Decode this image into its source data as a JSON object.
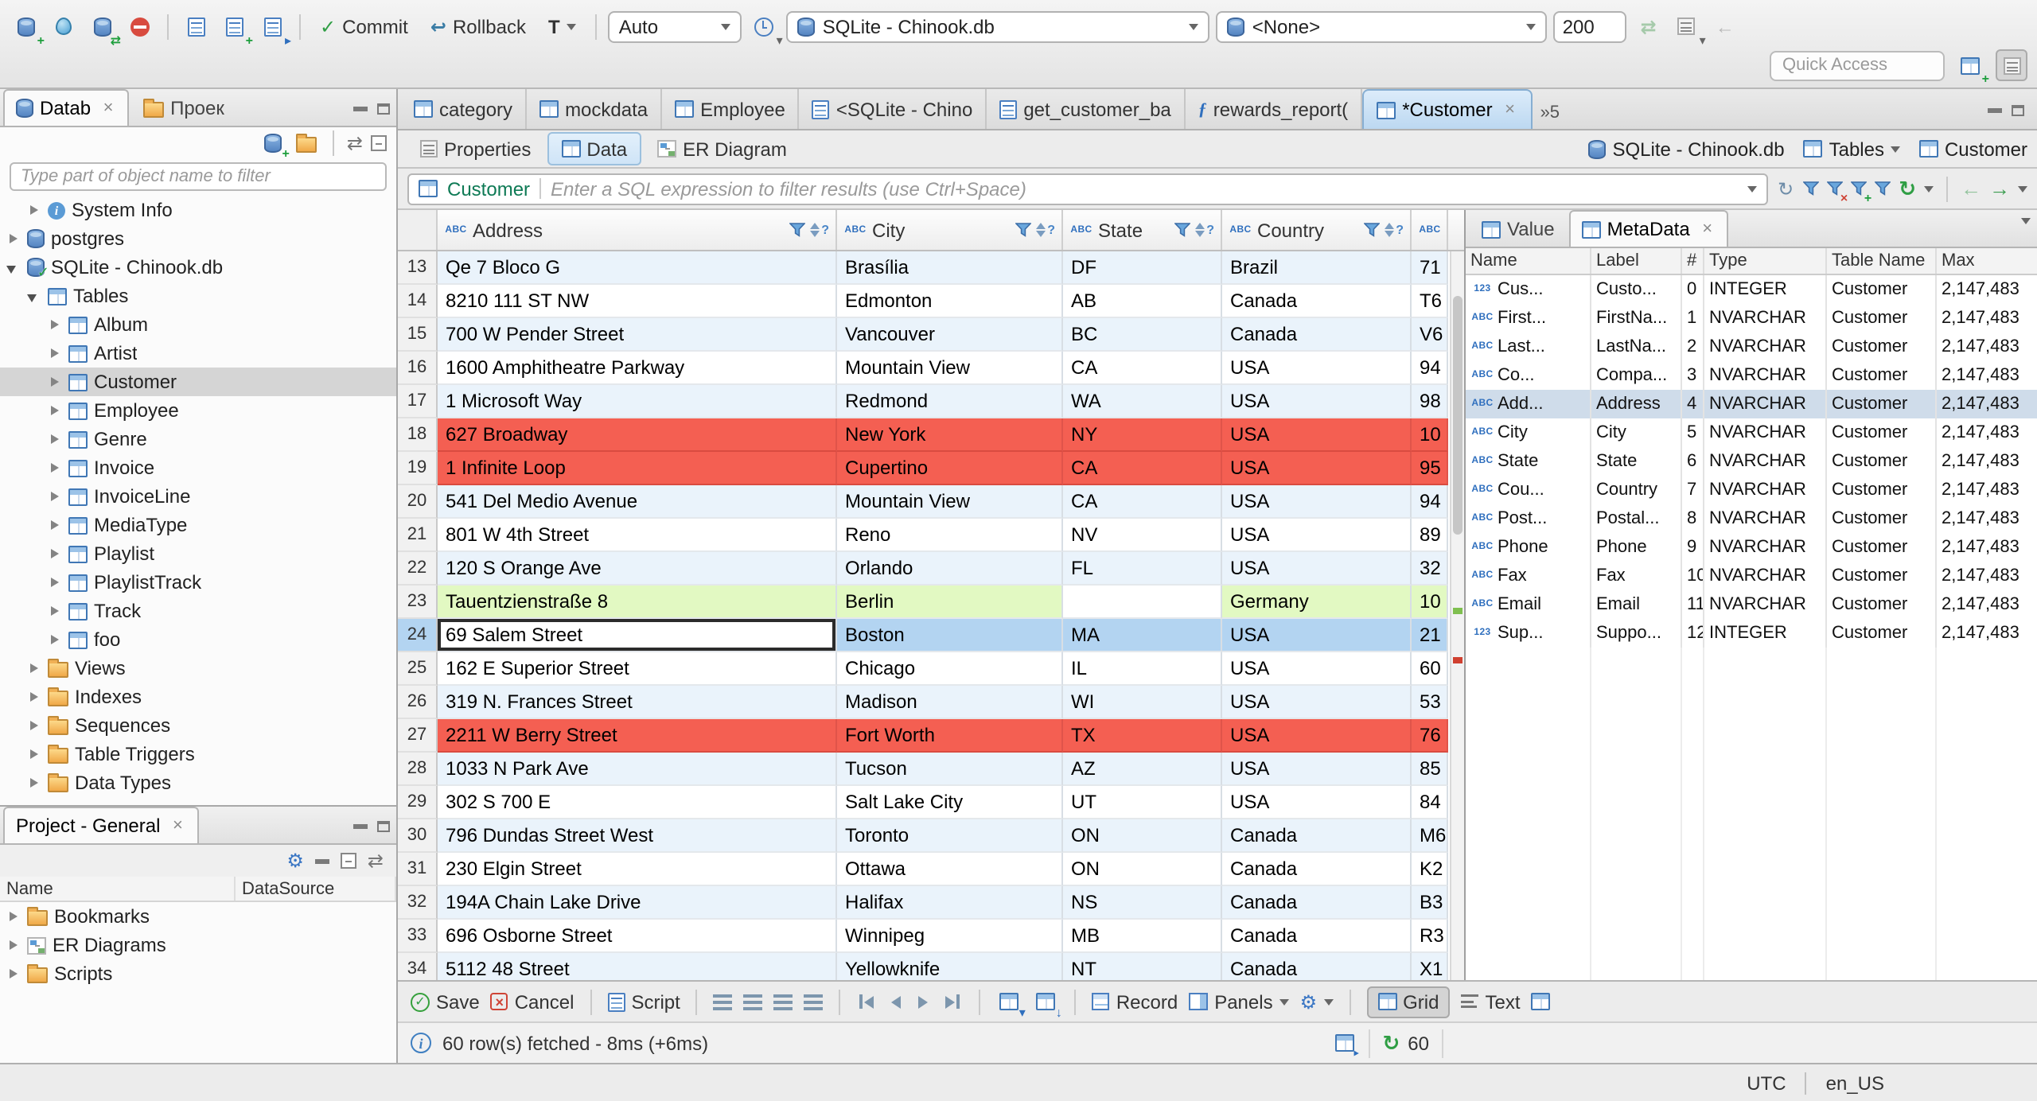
{
  "colors": {
    "accent_blue": "#3f7fc1",
    "row_red": "#f45f52",
    "row_green": "#e2f9c2",
    "selected_row_blue": "#b3d4f1",
    "active_tab_blue": "#bcd8f1",
    "filter_table_name_green": "#0e7a55",
    "refresh_green": "#2f9e44"
  },
  "toolbar": {
    "commit": "Commit",
    "rollback": "Rollback",
    "txn_mode": "T",
    "auto": "Auto",
    "connection": "SQLite - Chinook.db",
    "schema": "<None>",
    "fetch_size": "200",
    "quick_access": "Quick Access"
  },
  "navigator": {
    "tab_database": "Datab",
    "tab_projects": "Проек",
    "filter_placeholder": "Type part of object name to filter",
    "tree": [
      {
        "label": "System Info",
        "icon": "system-info",
        "depth": 1
      },
      {
        "label": "postgres",
        "icon": "database",
        "depth": 0
      },
      {
        "label": "SQLite - Chinook.db",
        "icon": "database-connected",
        "depth": 0,
        "expanded": true
      },
      {
        "label": "Tables",
        "icon": "table",
        "depth": 1,
        "expanded": true
      },
      {
        "label": "Album",
        "icon": "table",
        "depth": 2
      },
      {
        "label": "Artist",
        "icon": "table",
        "depth": 2
      },
      {
        "label": "Customer",
        "icon": "table",
        "depth": 2,
        "selected": true
      },
      {
        "label": "Employee",
        "icon": "table",
        "depth": 2
      },
      {
        "label": "Genre",
        "icon": "table",
        "depth": 2
      },
      {
        "label": "Invoice",
        "icon": "table",
        "depth": 2
      },
      {
        "label": "InvoiceLine",
        "icon": "table",
        "depth": 2
      },
      {
        "label": "MediaType",
        "icon": "table",
        "depth": 2
      },
      {
        "label": "Playlist",
        "icon": "table",
        "depth": 2
      },
      {
        "label": "PlaylistTrack",
        "icon": "table",
        "depth": 2
      },
      {
        "label": "Track",
        "icon": "table",
        "depth": 2
      },
      {
        "label": "foo",
        "icon": "table",
        "depth": 2
      },
      {
        "label": "Views",
        "icon": "folder",
        "depth": 1
      },
      {
        "label": "Indexes",
        "icon": "folder",
        "depth": 1
      },
      {
        "label": "Sequences",
        "icon": "folder",
        "depth": 1
      },
      {
        "label": "Table Triggers",
        "icon": "folder",
        "depth": 1
      },
      {
        "label": "Data Types",
        "icon": "folder",
        "depth": 1
      }
    ]
  },
  "project_panel": {
    "tab": "Project - General",
    "columns": [
      "Name",
      "DataSource"
    ],
    "items": [
      {
        "label": "Bookmarks",
        "icon": "folder"
      },
      {
        "label": "ER Diagrams",
        "icon": "diagram"
      },
      {
        "label": "Scripts",
        "icon": "folder"
      }
    ]
  },
  "editor": {
    "tabs": [
      {
        "label": "category",
        "icon": "table"
      },
      {
        "label": "mockdata",
        "icon": "table"
      },
      {
        "label": "Employee",
        "icon": "table"
      },
      {
        "label": "<SQLite - Chino",
        "icon": "sql"
      },
      {
        "label": "get_customer_ba",
        "icon": "sql"
      },
      {
        "label": "rewards_report(",
        "icon": "function"
      },
      {
        "label": "*Customer",
        "icon": "table",
        "active": true,
        "closable": true
      }
    ],
    "hidden_tabs": "»5",
    "subtabs": [
      {
        "label": "Properties",
        "icon": "properties"
      },
      {
        "label": "Data",
        "icon": "table",
        "active": true
      },
      {
        "label": "ER Diagram",
        "icon": "diagram"
      }
    ],
    "breadcrumb": [
      {
        "label": "SQLite - Chinook.db",
        "icon": "database"
      },
      {
        "label": "Tables",
        "icon": "table",
        "dropdown": true
      },
      {
        "label": "Customer",
        "icon": "table"
      }
    ],
    "filter_table": "Customer",
    "filter_placeholder": "Enter a SQL expression to filter results (use Ctrl+Space)"
  },
  "grid": {
    "columns": [
      {
        "label": "Address",
        "type": "abc"
      },
      {
        "label": "City",
        "type": "abc"
      },
      {
        "label": "State",
        "type": "abc"
      },
      {
        "label": "Country",
        "type": "abc"
      },
      {
        "label": "",
        "type": "abc"
      }
    ],
    "rows": [
      {
        "num": "13",
        "variant": "blue",
        "cells": [
          "Qe 7 Bloco G",
          "Brasília",
          "DF",
          "Brazil",
          "71"
        ]
      },
      {
        "num": "14",
        "variant": "white",
        "cells": [
          "8210 111 ST NW",
          "Edmonton",
          "AB",
          "Canada",
          "T6"
        ]
      },
      {
        "num": "15",
        "variant": "blue",
        "cells": [
          "700 W Pender Street",
          "Vancouver",
          "BC",
          "Canada",
          "V6"
        ]
      },
      {
        "num": "16",
        "variant": "white",
        "cells": [
          "1600 Amphitheatre Parkway",
          "Mountain View",
          "CA",
          "USA",
          "94"
        ]
      },
      {
        "num": "17",
        "variant": "blue",
        "cells": [
          "1 Microsoft Way",
          "Redmond",
          "WA",
          "USA",
          "98"
        ]
      },
      {
        "num": "18",
        "variant": "red",
        "cells": [
          "627 Broadway",
          "New York",
          "NY",
          "USA",
          "10"
        ]
      },
      {
        "num": "19",
        "variant": "red",
        "cells": [
          "1 Infinite Loop",
          "Cupertino",
          "CA",
          "USA",
          "95"
        ]
      },
      {
        "num": "20",
        "variant": "blue",
        "cells": [
          "541 Del Medio Avenue",
          "Mountain View",
          "CA",
          "USA",
          "94"
        ]
      },
      {
        "num": "21",
        "variant": "white",
        "cells": [
          "801 W 4th Street",
          "Reno",
          "NV",
          "USA",
          "89"
        ]
      },
      {
        "num": "22",
        "variant": "blue",
        "cells": [
          "120 S Orange Ave",
          "Orlando",
          "FL",
          "USA",
          "32"
        ]
      },
      {
        "num": "23",
        "variant": "green",
        "nullCells": [
          2
        ],
        "cells": [
          "Tauentzienstraße 8",
          "Berlin",
          "",
          "Germany",
          "10"
        ]
      },
      {
        "num": "24",
        "variant": "sel",
        "cells": [
          "69 Salem Street",
          "Boston",
          "MA",
          "USA",
          "21"
        ]
      },
      {
        "num": "25",
        "variant": "white",
        "cells": [
          "162 E Superior Street",
          "Chicago",
          "IL",
          "USA",
          "60"
        ]
      },
      {
        "num": "26",
        "variant": "blue",
        "cells": [
          "319 N. Frances Street",
          "Madison",
          "WI",
          "USA",
          "53"
        ]
      },
      {
        "num": "27",
        "variant": "red",
        "cells": [
          "2211 W Berry Street",
          "Fort Worth",
          "TX",
          "USA",
          "76"
        ]
      },
      {
        "num": "28",
        "variant": "blue",
        "cells": [
          "1033 N Park Ave",
          "Tucson",
          "AZ",
          "USA",
          "85"
        ]
      },
      {
        "num": "29",
        "variant": "white",
        "cells": [
          "302 S 700 E",
          "Salt Lake City",
          "UT",
          "USA",
          "84"
        ]
      },
      {
        "num": "30",
        "variant": "blue",
        "cells": [
          "796 Dundas Street West",
          "Toronto",
          "ON",
          "Canada",
          "M6"
        ]
      },
      {
        "num": "31",
        "variant": "white",
        "cells": [
          "230 Elgin Street",
          "Ottawa",
          "ON",
          "Canada",
          "K2"
        ]
      },
      {
        "num": "32",
        "variant": "blue",
        "cells": [
          "194A Chain Lake Drive",
          "Halifax",
          "NS",
          "Canada",
          "B3"
        ]
      },
      {
        "num": "33",
        "variant": "white",
        "cells": [
          "696 Osborne Street",
          "Winnipeg",
          "MB",
          "Canada",
          "R3"
        ]
      },
      {
        "num": "34",
        "variant": "blue",
        "cells": [
          "5112 48 Street",
          "Yellowknife",
          "NT",
          "Canada",
          "X1"
        ]
      }
    ]
  },
  "panel": {
    "tabs": [
      {
        "label": "Value",
        "icon": "grid"
      },
      {
        "label": "MetaData",
        "icon": "grid",
        "active": true,
        "closable": true
      }
    ],
    "columns": [
      "Name",
      "Label",
      "#",
      "Type",
      "Table Name",
      "Max"
    ],
    "rows": [
      {
        "icon": "123",
        "name": "Cus...",
        "label": "Custo...",
        "ord": "0",
        "type": "INTEGER",
        "table": "Customer",
        "max": "2,147,483"
      },
      {
        "icon": "abc",
        "name": "First...",
        "label": "FirstNa...",
        "ord": "1",
        "type": "NVARCHAR",
        "table": "Customer",
        "max": "2,147,483"
      },
      {
        "icon": "abc",
        "name": "Last...",
        "label": "LastNa...",
        "ord": "2",
        "type": "NVARCHAR",
        "table": "Customer",
        "max": "2,147,483"
      },
      {
        "icon": "abc",
        "name": "Co...",
        "label": "Compa...",
        "ord": "3",
        "type": "NVARCHAR",
        "table": "Customer",
        "max": "2,147,483"
      },
      {
        "icon": "abc",
        "name": "Add...",
        "label": "Address",
        "ord": "4",
        "type": "NVARCHAR",
        "table": "Customer",
        "max": "2,147,483",
        "selected": true
      },
      {
        "icon": "abc",
        "name": "City",
        "label": "City",
        "ord": "5",
        "type": "NVARCHAR",
        "table": "Customer",
        "max": "2,147,483"
      },
      {
        "icon": "abc",
        "name": "State",
        "label": "State",
        "ord": "6",
        "type": "NVARCHAR",
        "table": "Customer",
        "max": "2,147,483"
      },
      {
        "icon": "abc",
        "name": "Cou...",
        "label": "Country",
        "ord": "7",
        "type": "NVARCHAR",
        "table": "Customer",
        "max": "2,147,483"
      },
      {
        "icon": "abc",
        "name": "Post...",
        "label": "Postal...",
        "ord": "8",
        "type": "NVARCHAR",
        "table": "Customer",
        "max": "2,147,483"
      },
      {
        "icon": "abc",
        "name": "Phone",
        "label": "Phone",
        "ord": "9",
        "type": "NVARCHAR",
        "table": "Customer",
        "max": "2,147,483"
      },
      {
        "icon": "abc",
        "name": "Fax",
        "label": "Fax",
        "ord": "10",
        "type": "NVARCHAR",
        "table": "Customer",
        "max": "2,147,483"
      },
      {
        "icon": "abc",
        "name": "Email",
        "label": "Email",
        "ord": "11",
        "type": "NVARCHAR",
        "table": "Customer",
        "max": "2,147,483"
      },
      {
        "icon": "123",
        "name": "Sup...",
        "label": "Suppo...",
        "ord": "12",
        "type": "INTEGER",
        "table": "Customer",
        "max": "2,147,483"
      }
    ]
  },
  "result_toolbar": {
    "save": "Save",
    "cancel": "Cancel",
    "script": "Script",
    "record": "Record",
    "panels": "Panels",
    "grid": "Grid",
    "text": "Text"
  },
  "status": {
    "fetch": "60 row(s) fetched - 8ms (+6ms)",
    "refresh_count": "60",
    "timezone": "UTC",
    "locale": "en_US"
  }
}
